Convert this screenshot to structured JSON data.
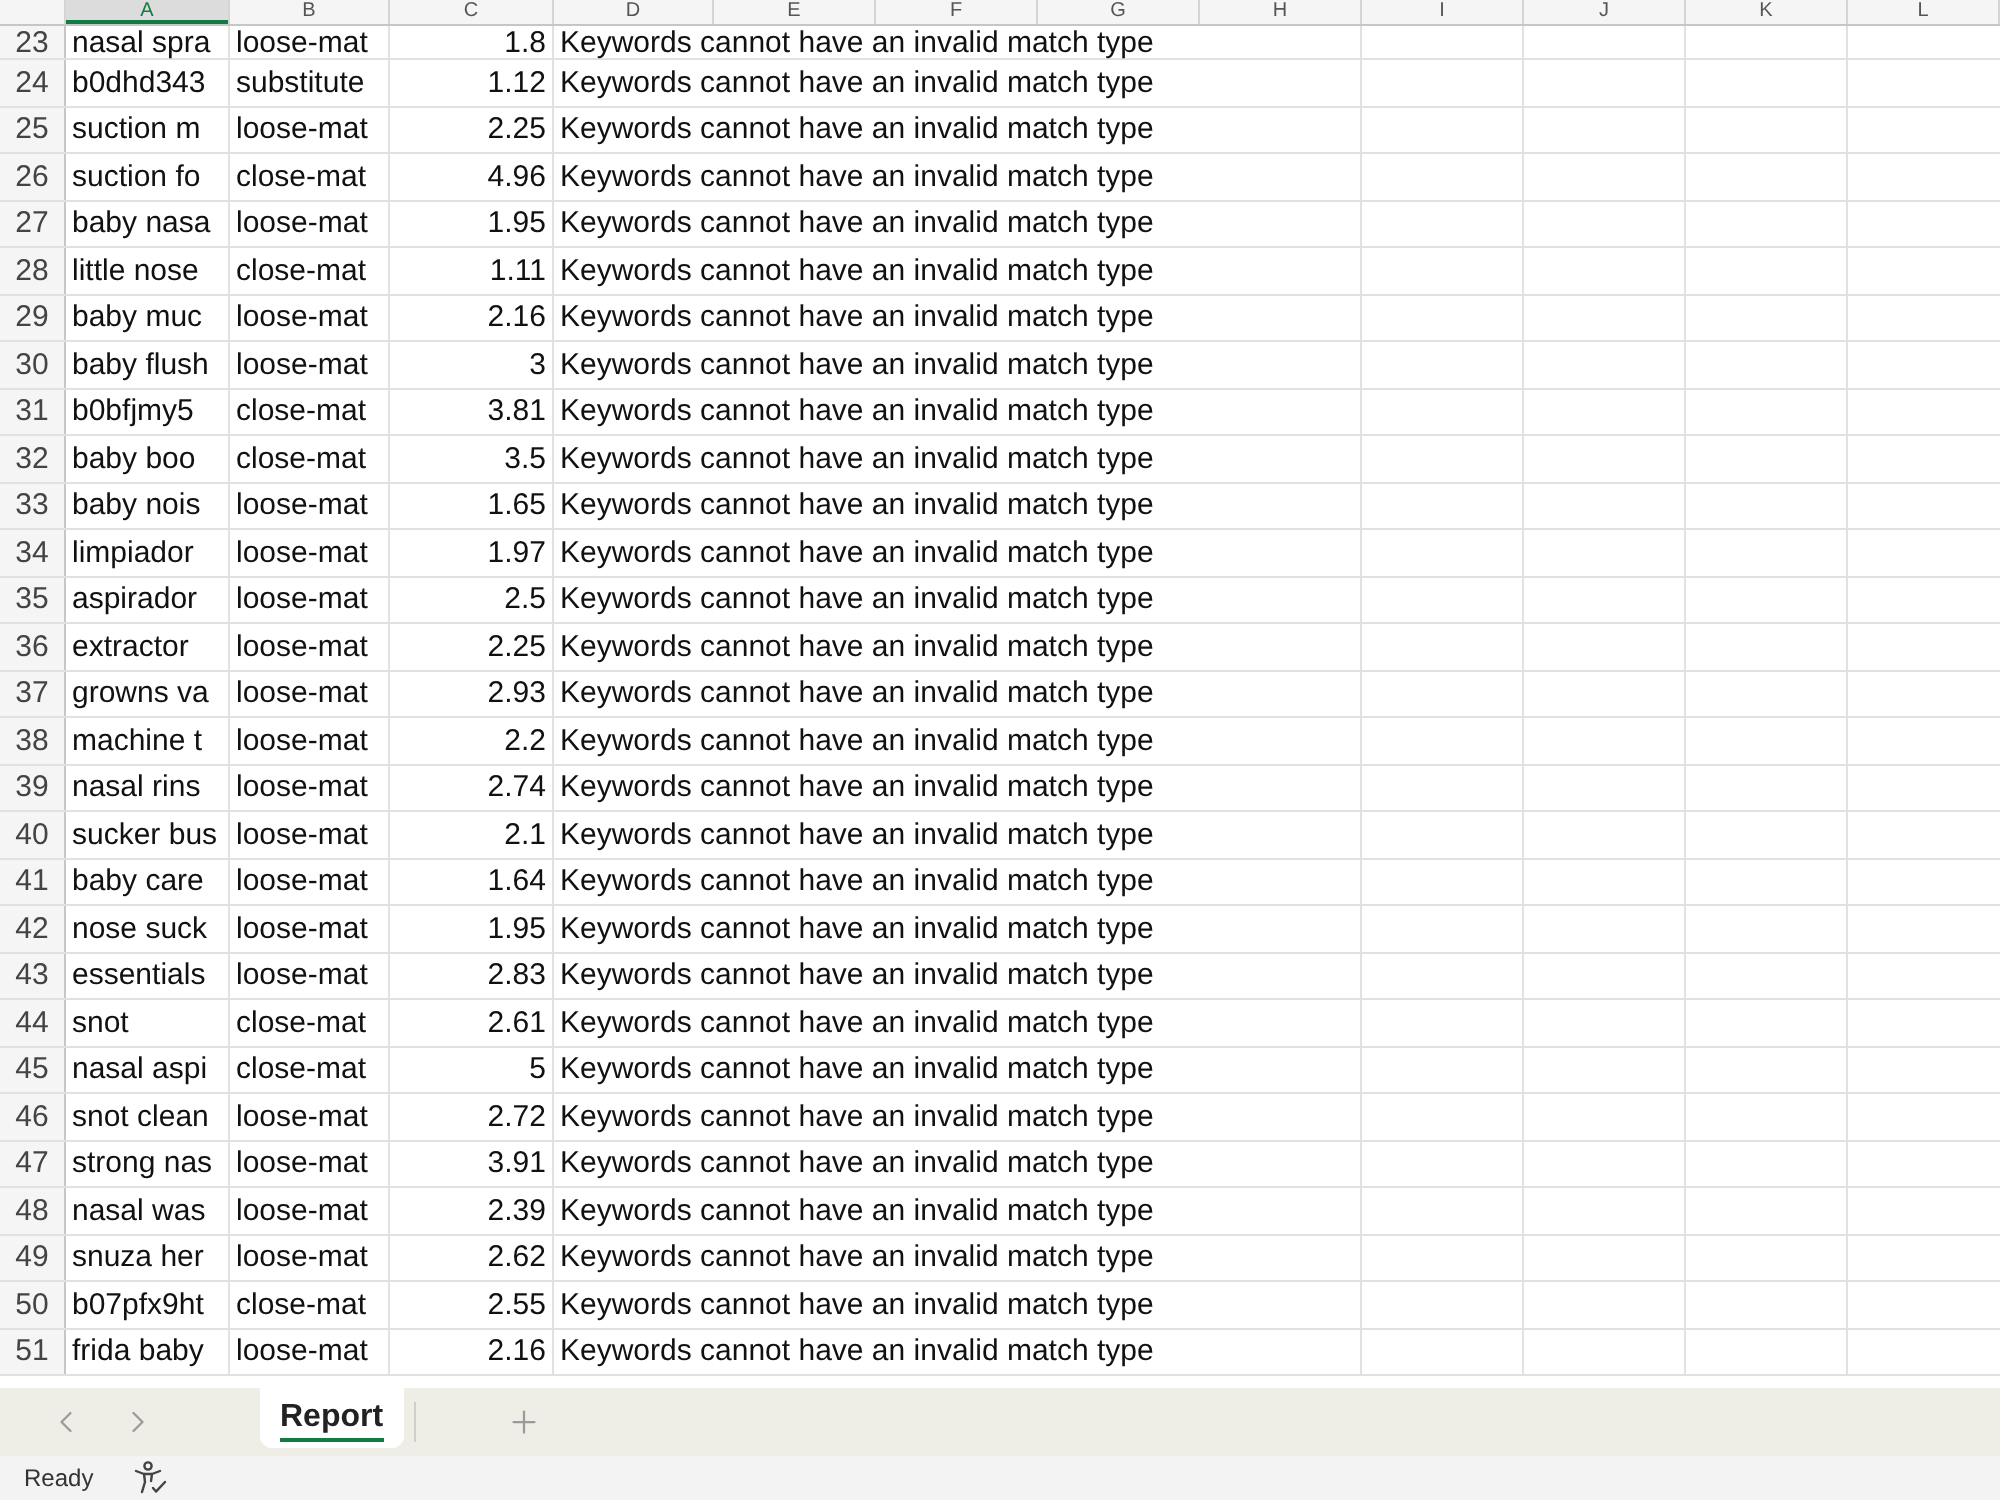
{
  "column_headers": [
    {
      "label": "A",
      "selected": true
    },
    {
      "label": "B",
      "selected": false
    },
    {
      "label": "C",
      "selected": false
    },
    {
      "label": "D",
      "selected": false
    },
    {
      "label": "E",
      "selected": false
    },
    {
      "label": "F",
      "selected": false
    },
    {
      "label": "G",
      "selected": false
    },
    {
      "label": "H",
      "selected": false
    },
    {
      "label": "I",
      "selected": false
    },
    {
      "label": "J",
      "selected": false
    },
    {
      "label": "K",
      "selected": false
    },
    {
      "label": "L",
      "selected": false
    }
  ],
  "rows": [
    {
      "number": "23",
      "cells": [
        "nasal spra",
        "loose-mat",
        "1.8",
        "Keywords cannot have an invalid match type"
      ]
    },
    {
      "number": "24",
      "cells": [
        "b0dhd343",
        "substitute",
        "1.12",
        "Keywords cannot have an invalid match type"
      ]
    },
    {
      "number": "25",
      "cells": [
        "suction m",
        "loose-mat",
        "2.25",
        "Keywords cannot have an invalid match type"
      ]
    },
    {
      "number": "26",
      "cells": [
        "suction fo",
        "close-mat",
        "4.96",
        "Keywords cannot have an invalid match type"
      ]
    },
    {
      "number": "27",
      "cells": [
        "baby nasa",
        "loose-mat",
        "1.95",
        "Keywords cannot have an invalid match type"
      ]
    },
    {
      "number": "28",
      "cells": [
        "little nose",
        "close-mat",
        "1.11",
        "Keywords cannot have an invalid match type"
      ]
    },
    {
      "number": "29",
      "cells": [
        "baby muc",
        "loose-mat",
        "2.16",
        "Keywords cannot have an invalid match type"
      ]
    },
    {
      "number": "30",
      "cells": [
        "baby flush",
        "loose-mat",
        "3",
        "Keywords cannot have an invalid match type"
      ]
    },
    {
      "number": "31",
      "cells": [
        "b0bfjmy5",
        "close-mat",
        "3.81",
        "Keywords cannot have an invalid match type"
      ]
    },
    {
      "number": "32",
      "cells": [
        "baby boo",
        "close-mat",
        "3.5",
        "Keywords cannot have an invalid match type"
      ]
    },
    {
      "number": "33",
      "cells": [
        "baby nois",
        "loose-mat",
        "1.65",
        "Keywords cannot have an invalid match type"
      ]
    },
    {
      "number": "34",
      "cells": [
        "limpiador",
        "loose-mat",
        "1.97",
        "Keywords cannot have an invalid match type"
      ]
    },
    {
      "number": "35",
      "cells": [
        "aspirador",
        "loose-mat",
        "2.5",
        "Keywords cannot have an invalid match type"
      ]
    },
    {
      "number": "36",
      "cells": [
        "extractor",
        "loose-mat",
        "2.25",
        "Keywords cannot have an invalid match type"
      ]
    },
    {
      "number": "37",
      "cells": [
        "growns va",
        "loose-mat",
        "2.93",
        "Keywords cannot have an invalid match type"
      ]
    },
    {
      "number": "38",
      "cells": [
        "machine t",
        "loose-mat",
        "2.2",
        "Keywords cannot have an invalid match type"
      ]
    },
    {
      "number": "39",
      "cells": [
        "nasal rins",
        "loose-mat",
        "2.74",
        "Keywords cannot have an invalid match type"
      ]
    },
    {
      "number": "40",
      "cells": [
        "sucker bus",
        "loose-mat",
        "2.1",
        "Keywords cannot have an invalid match type"
      ]
    },
    {
      "number": "41",
      "cells": [
        "baby care",
        "loose-mat",
        "1.64",
        "Keywords cannot have an invalid match type"
      ]
    },
    {
      "number": "42",
      "cells": [
        "nose suck",
        "loose-mat",
        "1.95",
        "Keywords cannot have an invalid match type"
      ]
    },
    {
      "number": "43",
      "cells": [
        "essentials",
        "loose-mat",
        "2.83",
        "Keywords cannot have an invalid match type"
      ]
    },
    {
      "number": "44",
      "cells": [
        "snot",
        "close-mat",
        "2.61",
        "Keywords cannot have an invalid match type"
      ]
    },
    {
      "number": "45",
      "cells": [
        "nasal aspi",
        "close-mat",
        "5",
        "Keywords cannot have an invalid match type"
      ]
    },
    {
      "number": "46",
      "cells": [
        "snot clean",
        "loose-mat",
        "2.72",
        "Keywords cannot have an invalid match type"
      ]
    },
    {
      "number": "47",
      "cells": [
        "strong nas",
        "loose-mat",
        "3.91",
        "Keywords cannot have an invalid match type"
      ]
    },
    {
      "number": "48",
      "cells": [
        "nasal was",
        "loose-mat",
        "2.39",
        "Keywords cannot have an invalid match type"
      ]
    },
    {
      "number": "49",
      "cells": [
        "snuza her",
        "loose-mat",
        "2.62",
        "Keywords cannot have an invalid match type"
      ]
    },
    {
      "number": "50",
      "cells": [
        "b07pfx9ht",
        "close-mat",
        "2.55",
        "Keywords cannot have an invalid match type"
      ]
    },
    {
      "number": "51",
      "cells": [
        "frida baby",
        "loose-mat",
        "2.16",
        "Keywords cannot have an invalid match type"
      ]
    }
  ],
  "sheet_tabs": [
    {
      "label": "Report",
      "selected": true
    }
  ],
  "status_bar": {
    "text": "Ready"
  }
}
